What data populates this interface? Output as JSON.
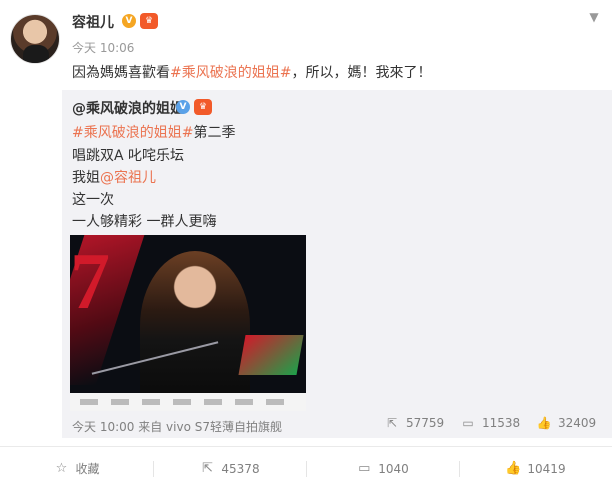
{
  "post": {
    "author": "容祖儿",
    "time": "今天 10:06",
    "text_before": "因為媽媽喜歡看",
    "text_link": "#乘风破浪的姐姐#",
    "text_after": "，所以，媽！我來了！"
  },
  "repost": {
    "author": "@乘风破浪的姐姐",
    "line1_link": "#乘风破浪的姐姐#",
    "line1_after": "第二季",
    "line2": "唱跳双A 叱咤乐坛",
    "line3_before": "我姐",
    "line3_link": "@容祖儿",
    "line4": "这一次",
    "line5": "一人够精彩 一群人更嗨",
    "meta": "今天 10:00 来自 vivo S7轻薄自拍旗舰",
    "reposts": "57759",
    "comments": "11538",
    "likes": "32409"
  },
  "actions": {
    "favorite": "收藏",
    "repost": "45378",
    "comment": "1040",
    "like": "10419"
  },
  "colors": {
    "link": "#eb7350",
    "muted": "#808080",
    "repost_bg": "#f2f2f5"
  },
  "icons": [
    "chevron-down-icon",
    "star-icon",
    "share-icon",
    "comment-icon",
    "thumbs-up-icon",
    "verified-icon"
  ]
}
